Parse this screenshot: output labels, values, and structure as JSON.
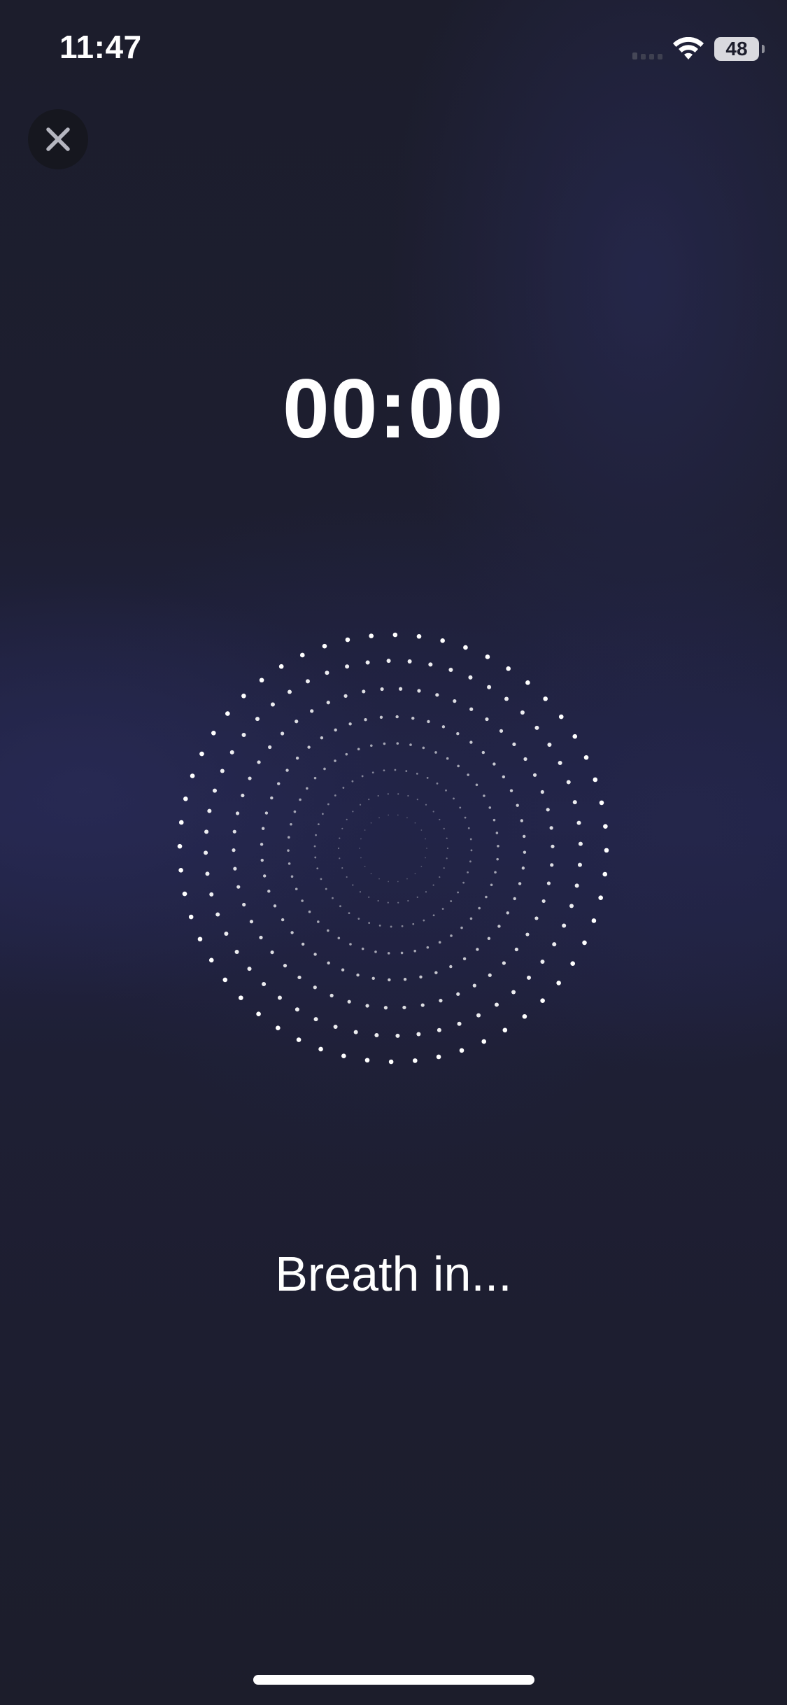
{
  "status_bar": {
    "time": "11:47",
    "battery": "48"
  },
  "timer": {
    "value": "00:00"
  },
  "instruction": {
    "text": "Breath in..."
  },
  "close_button": {
    "icon": "close-icon"
  },
  "colors": {
    "background": "#1c1d2b",
    "accent_glow": "#262850",
    "text": "#ffffff"
  }
}
